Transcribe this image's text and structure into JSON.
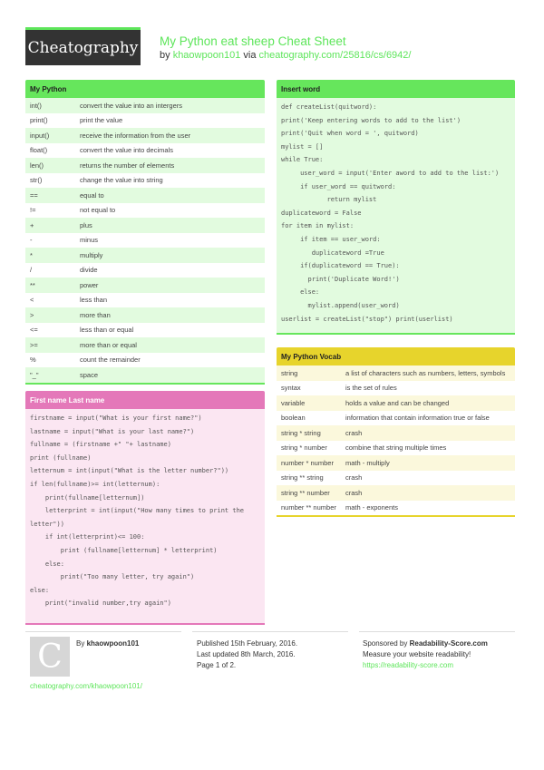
{
  "header": {
    "logo": "Cheatography",
    "title": "My Python eat sheep Cheat Sheet",
    "by_label": "by",
    "author": "khaowpoon101",
    "via_label": "via",
    "url": "cheatography.com/25816/cs/6942/"
  },
  "colors": {
    "green": "#66e65c",
    "pink": "#e478b9",
    "yellow": "#e7d42c",
    "link": "#5de55a",
    "logo_bg": "#333333"
  },
  "my_python": {
    "title": "My Python",
    "rows": [
      [
        "int()",
        "convert the value into an intergers"
      ],
      [
        "print()",
        "print the value"
      ],
      [
        "input()",
        "receive the information from the user"
      ],
      [
        "float()",
        "convert the value into decimals"
      ],
      [
        "len()",
        "returns the number of elements"
      ],
      [
        "str()",
        "change the value into string"
      ],
      [
        "==",
        "equal to"
      ],
      [
        "!=",
        "not equal to"
      ],
      [
        "+",
        "plus"
      ],
      [
        "-",
        "minus"
      ],
      [
        "*",
        "multiply"
      ],
      [
        "/",
        "divide"
      ],
      [
        "**",
        "power"
      ],
      [
        "<",
        "less than"
      ],
      [
        ">",
        "more than"
      ],
      [
        "<=",
        "less than or equal"
      ],
      [
        ">=",
        "more than or equal"
      ],
      [
        "%",
        "count the remainder"
      ],
      [
        "\"_\"",
        "space"
      ]
    ]
  },
  "first_last": {
    "title": "First name Last name",
    "lines": [
      "firstname = input(\"What is your first name?\")",
      "lastname = input(\"What is your last name?\")",
      "fullname = (firstname +\" \"+ lastname)",
      "print (fullname)",
      "letternum = int(input(\"What is the letter number?\"))",
      "if len(fullname)>= int(letternum):",
      "    print(fullname[letternum])",
      "    letterprint = int(input(\"How many times to print the letter\"))",
      "    if int(letterprint)<= 100:",
      "        print (fullname[letternum] * letterprint)",
      "    else:",
      "        print(\"Too many letter, try again\")",
      "else:",
      "    print(\"invalid number,try again\")"
    ]
  },
  "insert_word": {
    "title": "Insert word",
    "lines": [
      "def createList(quitword):",
      "print('Keep entering words to add to the list')",
      "print('Quit when word = ', quitword)",
      "mylist = []",
      "while True:",
      "     user_word = input('Enter aword to add to the list:')",
      "     if user_word == quitword:",
      "            return mylist",
      "duplicateword = False",
      "for item in mylist:",
      "     if item == user_word:",
      "        duplicateword =True",
      "     if(duplicateword == True):",
      "       print('Duplicate Word!')",
      "     else:",
      "       mylist.append(user_word)",
      "userlist = createList(\"stop\") print(userlist)"
    ]
  },
  "vocab": {
    "title": "My Python Vocab",
    "rows": [
      [
        "string",
        "a list of characters such as numbers, letters, symbols"
      ],
      [
        "syntax",
        "is the set of rules"
      ],
      [
        "variable",
        "holds a value and can be changed"
      ],
      [
        "boolean",
        "information that contain information true or false"
      ],
      [
        "string * string",
        "crash"
      ],
      [
        "string * number",
        "combine that string multiple times"
      ],
      [
        "number * number",
        "math - multiply"
      ],
      [
        "string ** string",
        "crash"
      ],
      [
        "string ** number",
        "crash"
      ],
      [
        "number ** number",
        "math - exponents"
      ]
    ]
  },
  "footer": {
    "avatar_letter": "C",
    "by_label": "By",
    "author": "khaowpoon101",
    "profile_url": "cheatography.com/khaowpoon101/",
    "published": "Published 15th February, 2016.",
    "updated": "Last updated 8th March, 2016.",
    "page": "Page 1 of 2.",
    "sponsored_label": "Sponsored by",
    "sponsor": "Readability-Score.com",
    "sponsor_tagline": "Measure your website readability!",
    "sponsor_url": "https://readability-score.com"
  }
}
